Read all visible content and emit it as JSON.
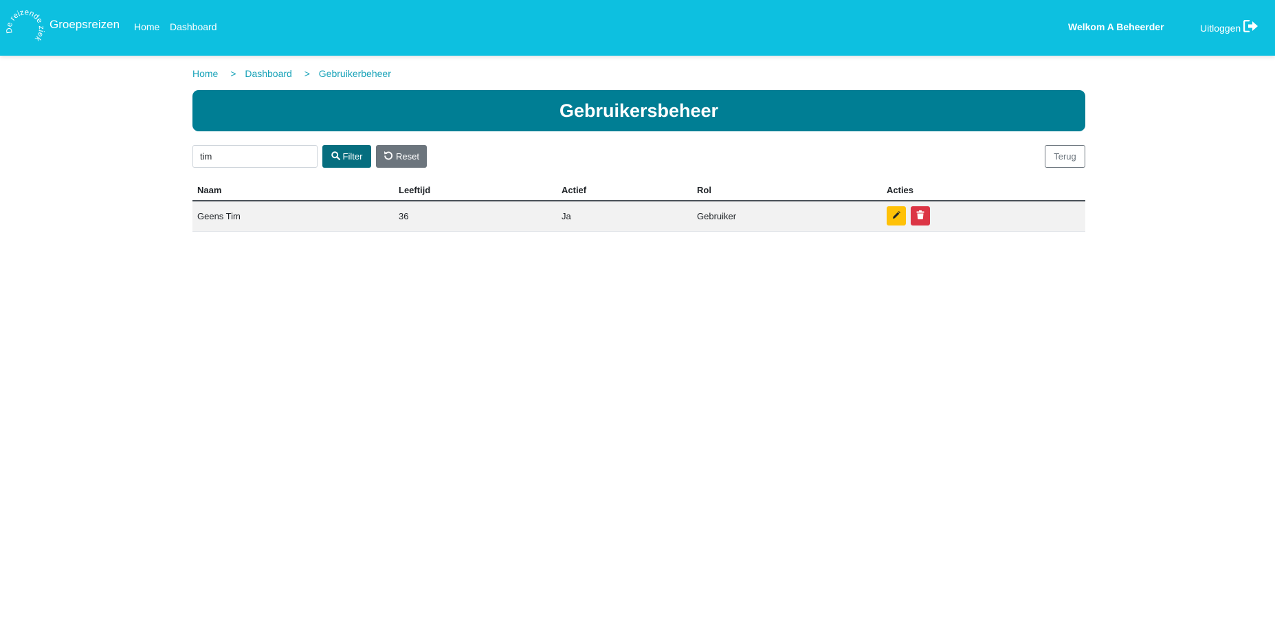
{
  "navbar": {
    "logo_text": "De reizende ziekenkas",
    "brand": "Groepsreizen",
    "links": {
      "home": "Home",
      "dashboard": "Dashboard"
    },
    "welcome": "Welkom A Beheerder",
    "logout": "Uitloggen",
    "logout_icon": "sign-out-icon"
  },
  "breadcrumb": {
    "items": [
      "Home",
      "Dashboard",
      "Gebruikerbeheer"
    ],
    "separator": ">"
  },
  "page": {
    "title": "Gebruikersbeheer"
  },
  "filter": {
    "search_value": "tim",
    "filter_label": "Filter",
    "filter_icon": "search-icon",
    "reset_label": "Reset",
    "reset_icon": "undo-icon",
    "back_label": "Terug"
  },
  "table": {
    "headers": [
      "Naam",
      "Leeftijd",
      "Actief",
      "Rol",
      "Acties"
    ],
    "rows": [
      {
        "naam": "Geens Tim",
        "leeftijd": "36",
        "actief": "Ja",
        "rol": "Gebruiker"
      }
    ],
    "action_icons": [
      "pencil-icon",
      "trash-icon"
    ]
  },
  "colors": {
    "navbar": "#0dc0e0",
    "title_banner": "#007e94",
    "filter_button": "#066e7f",
    "reset_button": "#6c757d",
    "edit_button": "#ffc107",
    "delete_button": "#dc3545",
    "breadcrumb": "#17a2b8"
  }
}
